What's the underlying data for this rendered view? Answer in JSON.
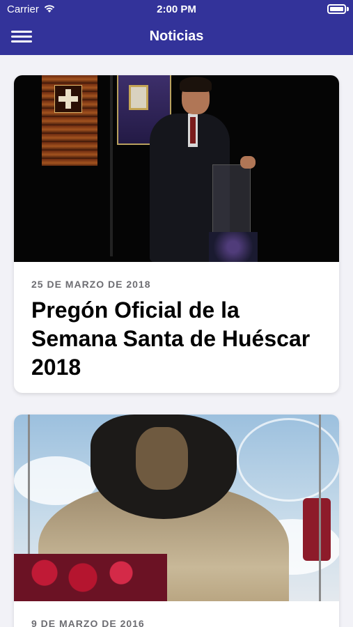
{
  "status_bar": {
    "carrier": "Carrier",
    "time": "2:00 PM",
    "wifi_icon": "wifi-icon",
    "battery_icon": "battery-icon"
  },
  "nav": {
    "title": "Noticias",
    "menu_icon": "hamburger-menu-icon"
  },
  "colors": {
    "nav_background": "#33339a",
    "page_background": "#f2f2f7",
    "date_text": "#6d6d72"
  },
  "news": [
    {
      "date": "25 DE MARZO DE 2018",
      "title": "Pregón Oficial de la Semana Santa de Huéscar 2018",
      "image": "speaker-at-lectern-photo"
    },
    {
      "date": "9 DE MARZO DE 2016",
      "title": "",
      "image": "statue-photo"
    }
  ]
}
